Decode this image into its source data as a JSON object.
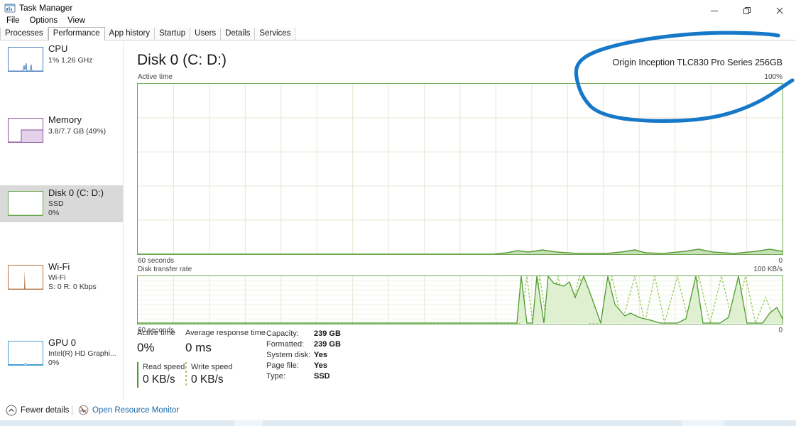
{
  "window": {
    "title": "Task Manager",
    "icon": "task-manager-icon",
    "controls": {
      "minimize": "─",
      "maximize": "❐",
      "close": "✕"
    }
  },
  "menu": {
    "items": [
      "File",
      "Options",
      "View"
    ]
  },
  "tabs": {
    "items": [
      {
        "label": "Processes",
        "active": false
      },
      {
        "label": "Performance",
        "active": true
      },
      {
        "label": "App history",
        "active": false
      },
      {
        "label": "Startup",
        "active": false
      },
      {
        "label": "Users",
        "active": false
      },
      {
        "label": "Details",
        "active": false
      },
      {
        "label": "Services",
        "active": false
      }
    ]
  },
  "sidebar": {
    "items": [
      {
        "title": "CPU",
        "sub1": "1%  1.26 GHz",
        "sub2": "",
        "color": "#4a7ebb",
        "selected": false
      },
      {
        "title": "Memory",
        "sub1": "3.8/7.7 GB (49%)",
        "sub2": "",
        "color": "#8c4f9e",
        "selected": false
      },
      {
        "title": "Disk 0 (C: D:)",
        "sub1": "SSD",
        "sub2": "0%",
        "color": "#6aa84f",
        "selected": true
      },
      {
        "title": "Wi-Fi",
        "sub1": "Wi-Fi",
        "sub2": "S: 0 R: 0 Kbps",
        "color": "#b5703c",
        "selected": false
      },
      {
        "title": "GPU 0",
        "sub1": "Intel(R) HD Graphi...",
        "sub2": "0%",
        "color": "#4a9bd1",
        "selected": false
      }
    ]
  },
  "main": {
    "title": "Disk 0 (C: D:)",
    "model": "Origin Inception TLC830 Pro Series 256GB",
    "active_graph": {
      "caption_left": "Active time",
      "caption_right": "100%",
      "axis_left": "60 seconds",
      "axis_right": "0"
    },
    "rate_graph": {
      "caption_left": "Disk transfer rate",
      "caption_right": "100 KB/s",
      "axis_left": "60 seconds",
      "axis_right": "0"
    },
    "stats": {
      "active_time_label": "Active time",
      "active_time_value": "0%",
      "avg_response_label": "Average response time",
      "avg_response_value": "0 ms",
      "read_speed_label": "Read speed",
      "read_speed_value": "0 KB/s",
      "write_speed_label": "Write speed",
      "write_speed_value": "0 KB/s",
      "info": [
        {
          "key": "Capacity:",
          "value": "239 GB"
        },
        {
          "key": "Formatted:",
          "value": "239 GB"
        },
        {
          "key": "System disk:",
          "value": "Yes"
        },
        {
          "key": "Page file:",
          "value": "Yes"
        },
        {
          "key": "Type:",
          "value": "SSD"
        }
      ]
    }
  },
  "footer": {
    "fewer_details": "Fewer details",
    "fewer_details_icon": "chevron-up-icon",
    "resource_monitor": "Open Resource Monitor",
    "resource_monitor_icon": "resource-monitor-icon"
  },
  "annotation": {
    "type": "hand-drawn-ellipse",
    "color": "#1778c8",
    "target": "disk-model-label"
  },
  "chart_data": [
    {
      "type": "area",
      "title": "Active time",
      "ylabel": "",
      "xlabel": "60 seconds",
      "ylim": [
        0,
        100
      ],
      "ytick_labels": [
        "100%",
        "0"
      ],
      "grid": true,
      "grid_cols": 18,
      "grid_rows": 5,
      "line_color": "#6aa84f",
      "fill_color": "#c5e0b4",
      "x": [
        0,
        5,
        10,
        15,
        20,
        25,
        30,
        35,
        40,
        45,
        50,
        55,
        58,
        60,
        62,
        65,
        68,
        70,
        72,
        75,
        78,
        80,
        82,
        85,
        88,
        90,
        92,
        95,
        97,
        100
      ],
      "values": [
        0,
        0,
        0,
        0,
        0,
        0,
        0,
        0,
        0,
        0,
        0,
        0,
        0.5,
        2,
        1,
        0.5,
        1.5,
        1,
        0.5,
        0.5,
        1,
        2.5,
        1,
        0.5,
        1,
        2,
        1.5,
        1,
        2.5,
        2
      ]
    },
    {
      "type": "line",
      "title": "Disk transfer rate",
      "ylabel": "",
      "xlabel": "60 seconds",
      "ylim": [
        0,
        100
      ],
      "ytick_labels": [
        "100 KB/s",
        "0"
      ],
      "grid": true,
      "grid_cols": 18,
      "grid_rows": 10,
      "series": [
        {
          "name": "read",
          "color": "#4e9a2f",
          "style": "solid",
          "x": [
            0,
            55,
            57,
            59,
            61,
            63,
            65,
            67,
            69,
            71,
            73,
            75,
            78,
            80,
            83,
            85,
            88,
            90,
            92,
            94,
            96,
            98,
            100
          ],
          "values": [
            0,
            0,
            100,
            0,
            0,
            60,
            100,
            0,
            45,
            38,
            30,
            0,
            5,
            8,
            20,
            3,
            0,
            0,
            3,
            6,
            55,
            100,
            8
          ]
        },
        {
          "name": "write",
          "color": "#9ccc65",
          "style": "dashed",
          "x": [
            0,
            55,
            58,
            60,
            62,
            64,
            67,
            70,
            73,
            76,
            79,
            82,
            85,
            88,
            91,
            93,
            95,
            97,
            100
          ],
          "values": [
            0,
            0,
            95,
            0,
            100,
            0,
            90,
            0,
            85,
            0,
            0,
            70,
            0,
            95,
            0,
            88,
            0,
            40,
            20
          ]
        }
      ]
    }
  ]
}
